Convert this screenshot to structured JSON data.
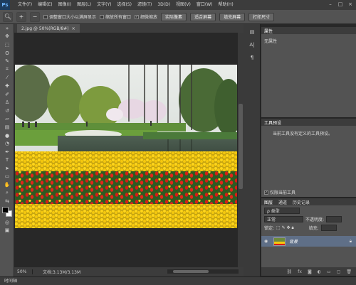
{
  "app": {
    "logo": "Ps"
  },
  "menu": [
    "文件(F)",
    "编辑(E)",
    "图像(I)",
    "图层(L)",
    "文字(Y)",
    "选择(S)",
    "滤镜(T)",
    "3D(D)",
    "视图(V)",
    "窗口(W)",
    "帮助(H)"
  ],
  "window_controls": [
    "–",
    "□",
    "×"
  ],
  "options": {
    "check1": "调整窗口大小以满屏显示",
    "check2": "缩放所有窗口",
    "check3": "细微缩放",
    "btn_actual": "实际像素",
    "btn_fit": "适合屏幕",
    "btn_fill": "填充屏幕",
    "btn_print": "打印尺寸"
  },
  "document": {
    "tab_label": "2.jpg @ 50%(RGB/8#)",
    "close": "×"
  },
  "status": {
    "zoom": "50%",
    "doc_info": "文档:3.13M/3.13M"
  },
  "timeline": {
    "label": "时间轴"
  },
  "properties": {
    "title": "属性",
    "content": "无属性"
  },
  "tool_presets": {
    "title": "工具预设",
    "message": "当前工具没有定义的工具预设。",
    "current_only": "仅限当前工具"
  },
  "layers": {
    "tabs": [
      "图层",
      "通道",
      "历史记录"
    ],
    "filter_kind": "ρ 类型",
    "blend_mode": "正常",
    "opacity_label": "不透明度:",
    "lock_label": "锁定:",
    "fill_label": "填充:",
    "layer_name": "背景"
  },
  "colors": {
    "accent_selected_layer": "#5f6f87",
    "foreground": "#000000",
    "background": "#ffffff"
  }
}
